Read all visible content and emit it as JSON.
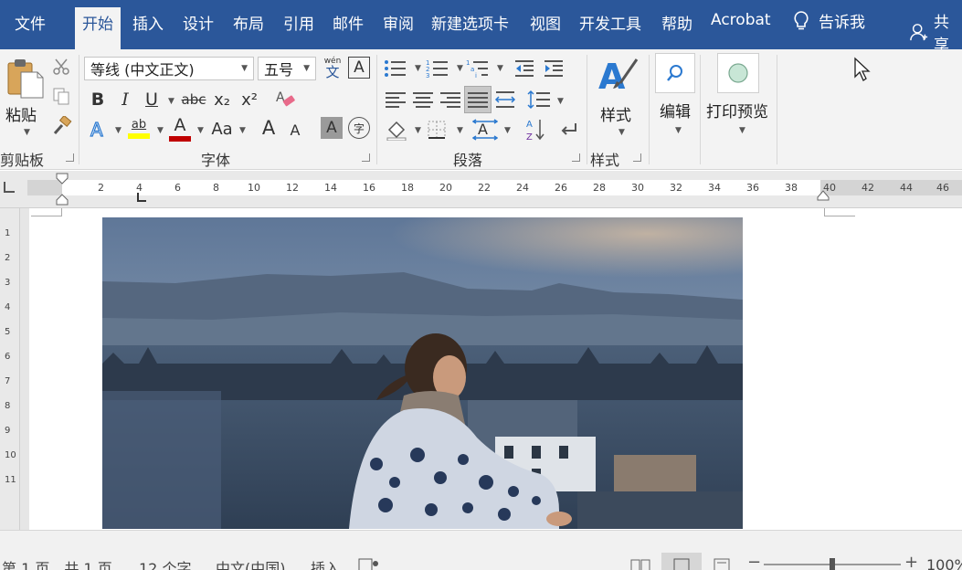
{
  "menu": {
    "tabs": [
      "文件",
      "开始",
      "插入",
      "设计",
      "布局",
      "引用",
      "邮件",
      "审阅",
      "新建选项卡",
      "视图",
      "开发工具",
      "帮助",
      "Acrobat"
    ],
    "active_tab": "开始",
    "tell_me": "告诉我",
    "share": "共享"
  },
  "ribbon": {
    "clipboard": {
      "group_label": "剪贴板",
      "paste_label": "粘贴"
    },
    "font": {
      "group_label": "字体",
      "font_name": "等线 (中文正文)",
      "font_size": "五号",
      "phonetic_top": "wén",
      "phonetic_bottom": "文",
      "boxed_char": "A",
      "bold": "B",
      "italic": "I",
      "underline": "U",
      "strikethrough": "abc",
      "subscript": "x₂",
      "superscript": "x²",
      "highlight_text": "ab",
      "font_color_letter": "A",
      "change_case": "Aa",
      "grow_font": "A",
      "shrink_font": "A",
      "char_shading": "A",
      "enclose_char": "字"
    },
    "paragraph": {
      "group_label": "段落"
    },
    "styles": {
      "group_label": "样式",
      "styles_button": "样式"
    },
    "editing": {
      "edit_button": "编辑"
    },
    "print_preview": {
      "button": "打印预览"
    }
  },
  "ruler": {
    "labels": [
      "2",
      "4",
      "6",
      "8",
      "10",
      "12",
      "14",
      "16",
      "18",
      "20",
      "22",
      "24",
      "26",
      "28",
      "30",
      "32",
      "34",
      "36",
      "38",
      "40",
      "42",
      "44",
      "46"
    ]
  },
  "vertical_ruler": {
    "labels": [
      "1",
      "2",
      "3",
      "4",
      "5",
      "6",
      "7",
      "8",
      "9",
      "10",
      "11"
    ]
  },
  "status": {
    "page": "第 1 页，共 1 页",
    "words": "12 个字",
    "language": "中文(中国)",
    "insert_mode": "插入",
    "zoom": "100%"
  },
  "colors": {
    "title_bar": "#2b579a",
    "ribbon_bg": "#f3f3f3",
    "highlight_yellow": "#ffff00",
    "font_red": "#c00000"
  }
}
